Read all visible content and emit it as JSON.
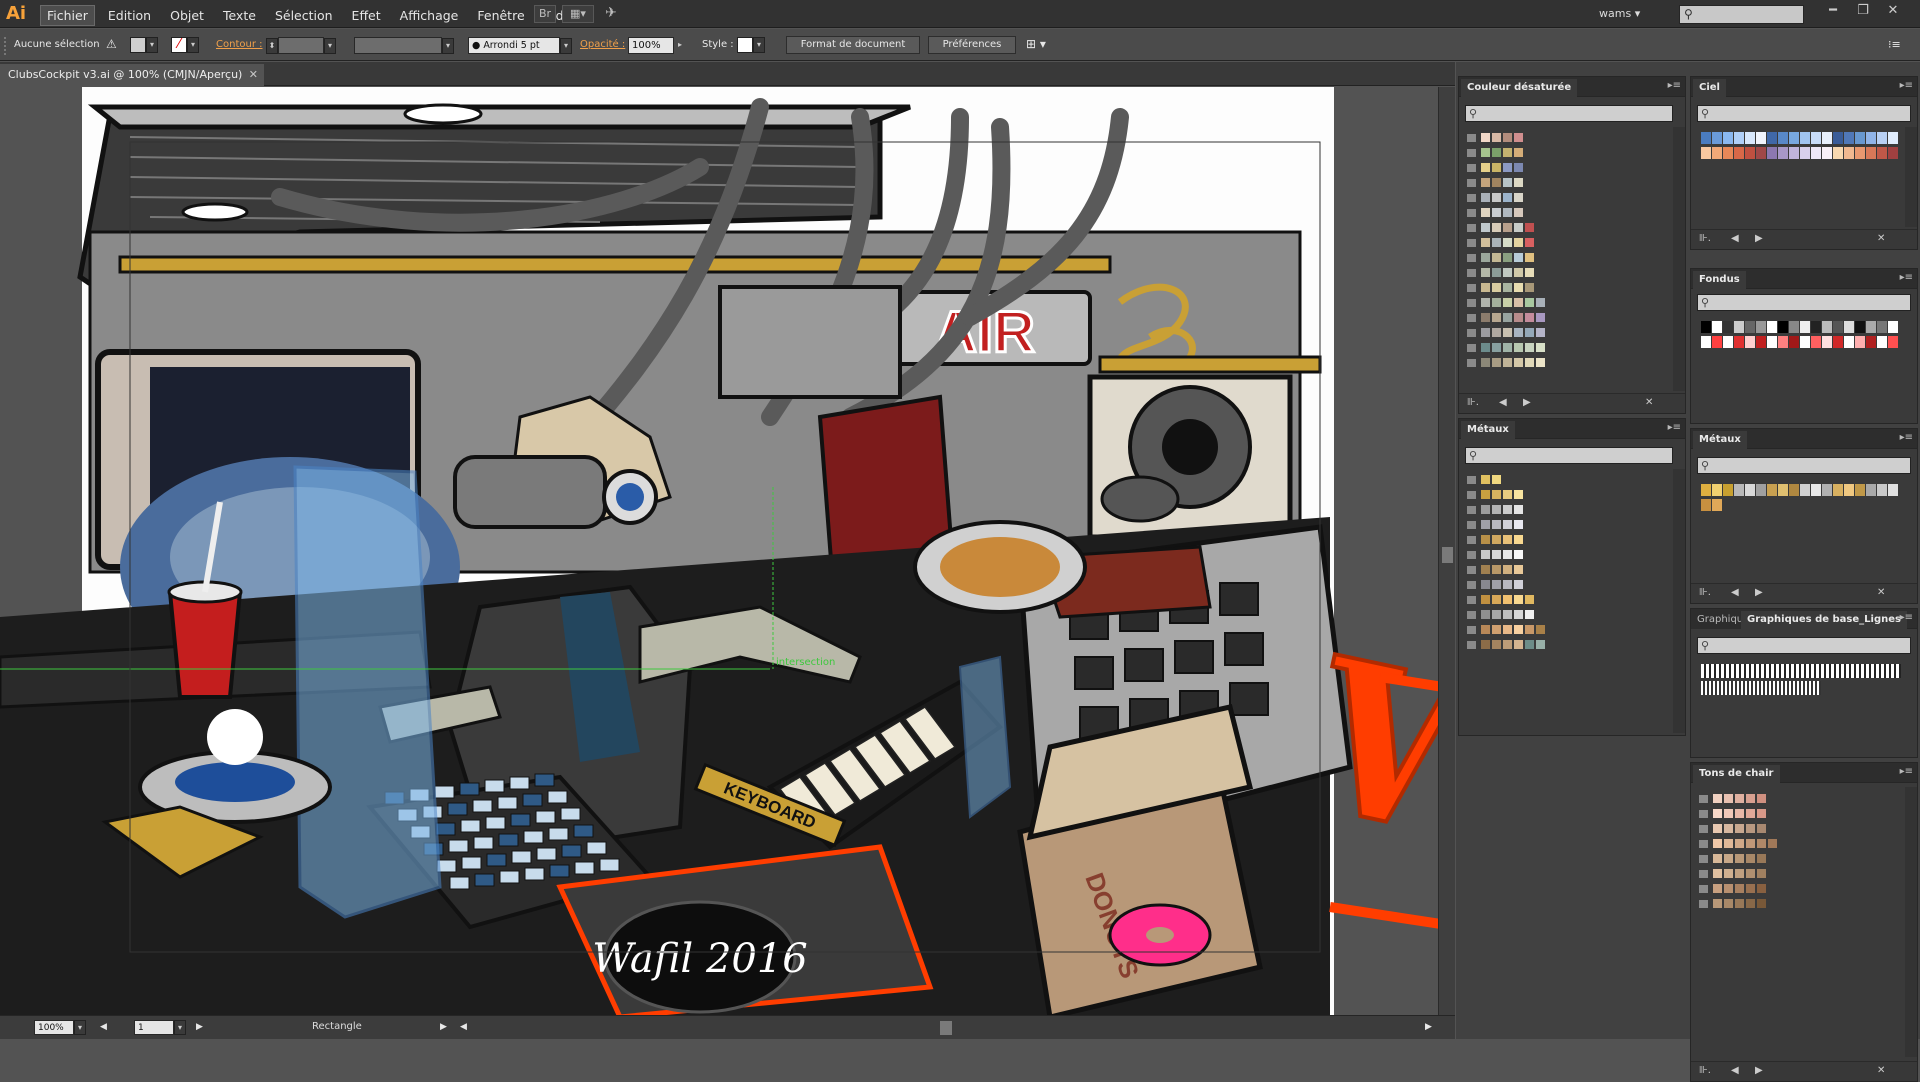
{
  "app": {
    "logo": "Ai",
    "workspace": "wams",
    "workspace_arrow": "▾",
    "search_placeholder": "",
    "window_controls": [
      "━",
      "❐",
      "✕"
    ]
  },
  "menu": {
    "items": [
      "Fichier",
      "Edition",
      "Objet",
      "Texte",
      "Sélection",
      "Effet",
      "Affichage",
      "Fenêtre",
      "Aide"
    ],
    "active_index": 0,
    "icons": [
      "bridge-icon",
      "arrange-documents-icon",
      "gpu-preview-icon"
    ]
  },
  "control_bar": {
    "selection_label": "Aucune sélection",
    "warning_icon": "⚠",
    "fill_color": "#cfcfcf",
    "stroke_label": "Contour :",
    "brush_value": "Arrondi 5 pt",
    "opacity_label": "Opacité :",
    "opacity_value": "100%",
    "style_label": "Style :",
    "doc_format_btn": "Format de document",
    "prefs_btn": "Préférences",
    "menu_icon": "⁝≡"
  },
  "document": {
    "tab_title": "ClubsCockpit v3.ai @ 100% (CMJN/Aperçu)",
    "close": "✕"
  },
  "artwork": {
    "on_air": "AIR",
    "keyboard": "KEYBOARD",
    "donuts": "DONUTS",
    "signature": "Wafil 2016",
    "stamp": "WIP",
    "smart_guide": "intersection",
    "colors": {
      "accent_orange": "#ff3d00",
      "gold": "#c9a035",
      "sign_red": "#c22020",
      "screen_blue": "#7ab4e6",
      "donut_pink": "#ff2e8a"
    }
  },
  "status": {
    "zoom": "100%",
    "artboard": "1",
    "tool": "Rectangle",
    "arrows": [
      "◀",
      "▶"
    ]
  },
  "panels": {
    "couleur": {
      "title": "Couleur désaturée",
      "footer": [
        "lib-menu-icon",
        "prev-icon",
        "next-icon",
        "close-icon"
      ]
    },
    "ciel": {
      "title": "Ciel"
    },
    "fondus": {
      "title": "Fondus"
    },
    "metaux_left": {
      "title": "Métaux"
    },
    "metaux_right": {
      "title": "Métaux"
    },
    "graphiques": {
      "title_inactive": "Graphique",
      "title": "Graphiques de base_Lignes"
    },
    "tons_chair": {
      "title": "Tons de chair"
    }
  },
  "swatch_rows": {
    "couleur": [
      [
        "#f2d8c8",
        "#d9b9a6",
        "#b38c7c",
        "#d08e8e"
      ],
      [
        "#a6c48e",
        "#7ba06a",
        "#c4b270",
        "#d4ad78"
      ],
      [
        "#e6d08a",
        "#c9b466",
        "#8c9ac4",
        "#7c88b0"
      ],
      [
        "#c4a47c",
        "#a08460",
        "#b8c4c8",
        "#dcd8c4"
      ],
      [
        "#aab0b8",
        "#c8c8c8",
        "#9cb4cc",
        "#d8d4c8"
      ],
      [
        "#e0d4c0",
        "#c8ccd0",
        "#b0b8c0",
        "#d6c8bc"
      ],
      [
        "#c0c8cc",
        "#d8ccb8",
        "#b8a08c",
        "#c8ccc8",
        "#c05050"
      ],
      [
        "#d2c09c",
        "#aab4b8",
        "#d6dcc8",
        "#e4d4a0",
        "#d86060"
      ],
      [
        "#9ca89c",
        "#c4b894",
        "#8aa080",
        "#b8ccd8",
        "#e0c080"
      ],
      [
        "#b4b8a8",
        "#8c9c98",
        "#c0c8c0",
        "#d0c8a8",
        "#e6dcb8"
      ],
      [
        "#c8b890",
        "#d8cca0",
        "#a8b4a0",
        "#e8dcb0",
        "#a89878"
      ],
      [
        "#b0b4ac",
        "#a4b09c",
        "#c8d0a8",
        "#d8c0a8",
        "#a8c8a0",
        "#a8b0b8"
      ],
      [
        "#8c7c6c",
        "#b8a890",
        "#98a4a0",
        "#b88c8c",
        "#c48c9c",
        "#a898c0"
      ],
      [
        "#9c9ca0",
        "#b0a8a0",
        "#c8c0b0",
        "#a8b4c0",
        "#94a8b8",
        "#b4b4c8"
      ],
      [
        "#6c8c8c",
        "#88a0a0",
        "#a0b4a8",
        "#b8c8b0",
        "#c8d4c0",
        "#d8e0c8"
      ],
      [
        "#8c8878",
        "#a89c84",
        "#c0b498",
        "#d4c8a8",
        "#e0d8b8",
        "#ece4c8"
      ]
    ],
    "metaux": [
      [
        "#e0c060",
        "#f0d880"
      ],
      [
        "#c8a040",
        "#d8b460",
        "#e8cc80",
        "#f8e4a0"
      ],
      [
        "#9c9c9c",
        "#b4b4b4",
        "#cccccc",
        "#e4e4e4"
      ],
      [
        "#a0a0a8",
        "#b8b8c0",
        "#d0d0d8",
        "#e8e8f0"
      ],
      [
        "#b89048",
        "#d0a860",
        "#e8c078",
        "#f8d890"
      ],
      [
        "#c8c8c8",
        "#d8d8d8",
        "#e8e8e8",
        "#f8f8f8"
      ],
      [
        "#a08050",
        "#b89868",
        "#d0b080",
        "#e8c898"
      ],
      [
        "#888890",
        "#a0a0a8",
        "#b8b8c0",
        "#d0d0d8"
      ],
      [
        "#c09040",
        "#d8a858",
        "#f0c070",
        "#f8d890",
        "#e0b860"
      ],
      [
        "#909090",
        "#a8a8a8",
        "#c0c0c0",
        "#d8d8d8",
        "#f0f0f0"
      ],
      [
        "#b88858",
        "#d0a070",
        "#e8b888",
        "#f8d0a0",
        "#c89868",
        "#a88048"
      ],
      [
        "#8c6c48",
        "#a48460",
        "#bc9c78",
        "#d4b490",
        "#6c8c88",
        "#98b0a8"
      ]
    ],
    "tons_chair": [
      [
        "#f0d0c0",
        "#e8c0b0",
        "#e0b0a0",
        "#d8a090",
        "#d09080"
      ],
      [
        "#f8d8c8",
        "#f0c8b8",
        "#e8b8a8",
        "#e0a898",
        "#d89888"
      ],
      [
        "#e8c8b0",
        "#d8b8a0",
        "#c8a890",
        "#b89880",
        "#a88870"
      ],
      [
        "#f0c8a8",
        "#e0b898",
        "#d0a888",
        "#c09878",
        "#b08868",
        "#a07858"
      ],
      [
        "#d8b898",
        "#c8a888",
        "#b89878",
        "#a88868",
        "#987858"
      ],
      [
        "#e0c0a0",
        "#d0b090",
        "#c0a080",
        "#b09070",
        "#a08060"
      ],
      [
        "#c8a080",
        "#b89070",
        "#a88060",
        "#987050",
        "#886040"
      ],
      [
        "#b89878",
        "#a88868",
        "#987858",
        "#886848",
        "#785838"
      ]
    ]
  },
  "strips": {
    "ciel_1": [
      "#4a7cc0",
      "#6a9ad8",
      "#8ab8f0",
      "#b0d0f8",
      "#d8e8fc",
      "#f0f4fc",
      "#4068a8",
      "#5888c8",
      "#78a8e0",
      "#a0c4f0",
      "#c8dcf8",
      "#e8f0fc",
      "#3a5c98",
      "#5078b8",
      "#6898d0",
      "#90b4e8",
      "#b8d0f4",
      "#e0ecfc"
    ],
    "ciel_2": [
      "#f8c8a0",
      "#f0a878",
      "#e88858",
      "#d86848",
      "#c05040",
      "#a04848",
      "#8c78b0",
      "#a898c8",
      "#c0b4dc",
      "#d8d0ec",
      "#eee8f8",
      "#f8f0f8",
      "#f8d8b0",
      "#f0b890",
      "#e89870",
      "#d87858",
      "#c05848",
      "#a04040"
    ],
    "fondus_1": [
      "#000000",
      "#ffffff",
      "#333333",
      "#cccccc",
      "#666666",
      "#999999",
      "#ffffff",
      "#000000",
      "#888888",
      "#eeeeee",
      "#222222",
      "#bbbbbb",
      "#555555",
      "#dddddd",
      "#111111",
      "#aaaaaa",
      "#777777",
      "#ffffff"
    ],
    "fondus_2": [
      "#ffffff",
      "#ff4040",
      "#ffffff",
      "#e03030",
      "#ffd0d0",
      "#c02020",
      "#ffffff",
      "#ff8080",
      "#a01818",
      "#ffffff",
      "#ff6060",
      "#ffe0e0",
      "#d02828",
      "#ffffff",
      "#ffb0b0",
      "#b02020",
      "#ffffff",
      "#ff5050"
    ],
    "metaux_r1": [
      "#e0b040",
      "#f0d070",
      "#c8a030",
      "#b8b8b8",
      "#d8d8d8",
      "#a0a0a0",
      "#c8a050",
      "#e0c070",
      "#b08840",
      "#d0d0d0",
      "#e8e8e8",
      "#b0b0b0",
      "#d8b060",
      "#f0c880",
      "#c09848",
      "#a8a8a8",
      "#c8c8c8",
      "#e0e0e0"
    ],
    "metaux_r2": [
      "#c89040",
      "#e0a858"
    ]
  },
  "assets": {
    "icons": [
      "search-icon",
      "folder-icon",
      "grid-icon",
      "brush-icon",
      "zoom-icon"
    ]
  }
}
